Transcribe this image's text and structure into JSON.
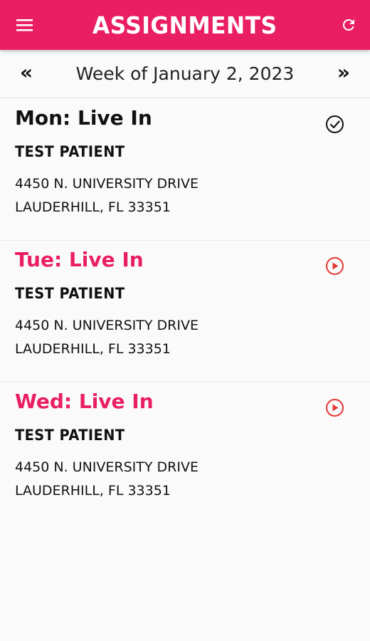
{
  "header": {
    "title": "ASSIGNMENTS",
    "menu_icon": "hamburger-menu-icon",
    "refresh_icon": "refresh-icon",
    "color": "#e91e63"
  },
  "week_nav": {
    "prev_label": "«",
    "week_label": "Week of January 2, 2023",
    "next_label": "»"
  },
  "assignments": [
    {
      "day": "Mon: Live In",
      "patient": "TEST PATIENT",
      "address_line1": "4450 N. UNIVERSITY DRIVE",
      "address_line2": "LAUDERHILL, FL 33351",
      "status": "completed",
      "status_icon": "check-circle-icon",
      "day_color": "#111111"
    },
    {
      "day": "Tue: Live In",
      "patient": "TEST PATIENT",
      "address_line1": "4450 N. UNIVERSITY DRIVE",
      "address_line2": "LAUDERHILL, FL 33351",
      "status": "pending",
      "status_icon": "play-circle-icon",
      "day_color": "#e91e63"
    },
    {
      "day": "Wed: Live In",
      "patient": "TEST PATIENT",
      "address_line1": "4450 N. UNIVERSITY DRIVE",
      "address_line2": "LAUDERHILL, FL 33351",
      "status": "pending",
      "status_icon": "play-circle-icon",
      "day_color": "#e91e63"
    }
  ],
  "colors": {
    "accent": "#e91e63",
    "play_icon": "#e53935"
  }
}
